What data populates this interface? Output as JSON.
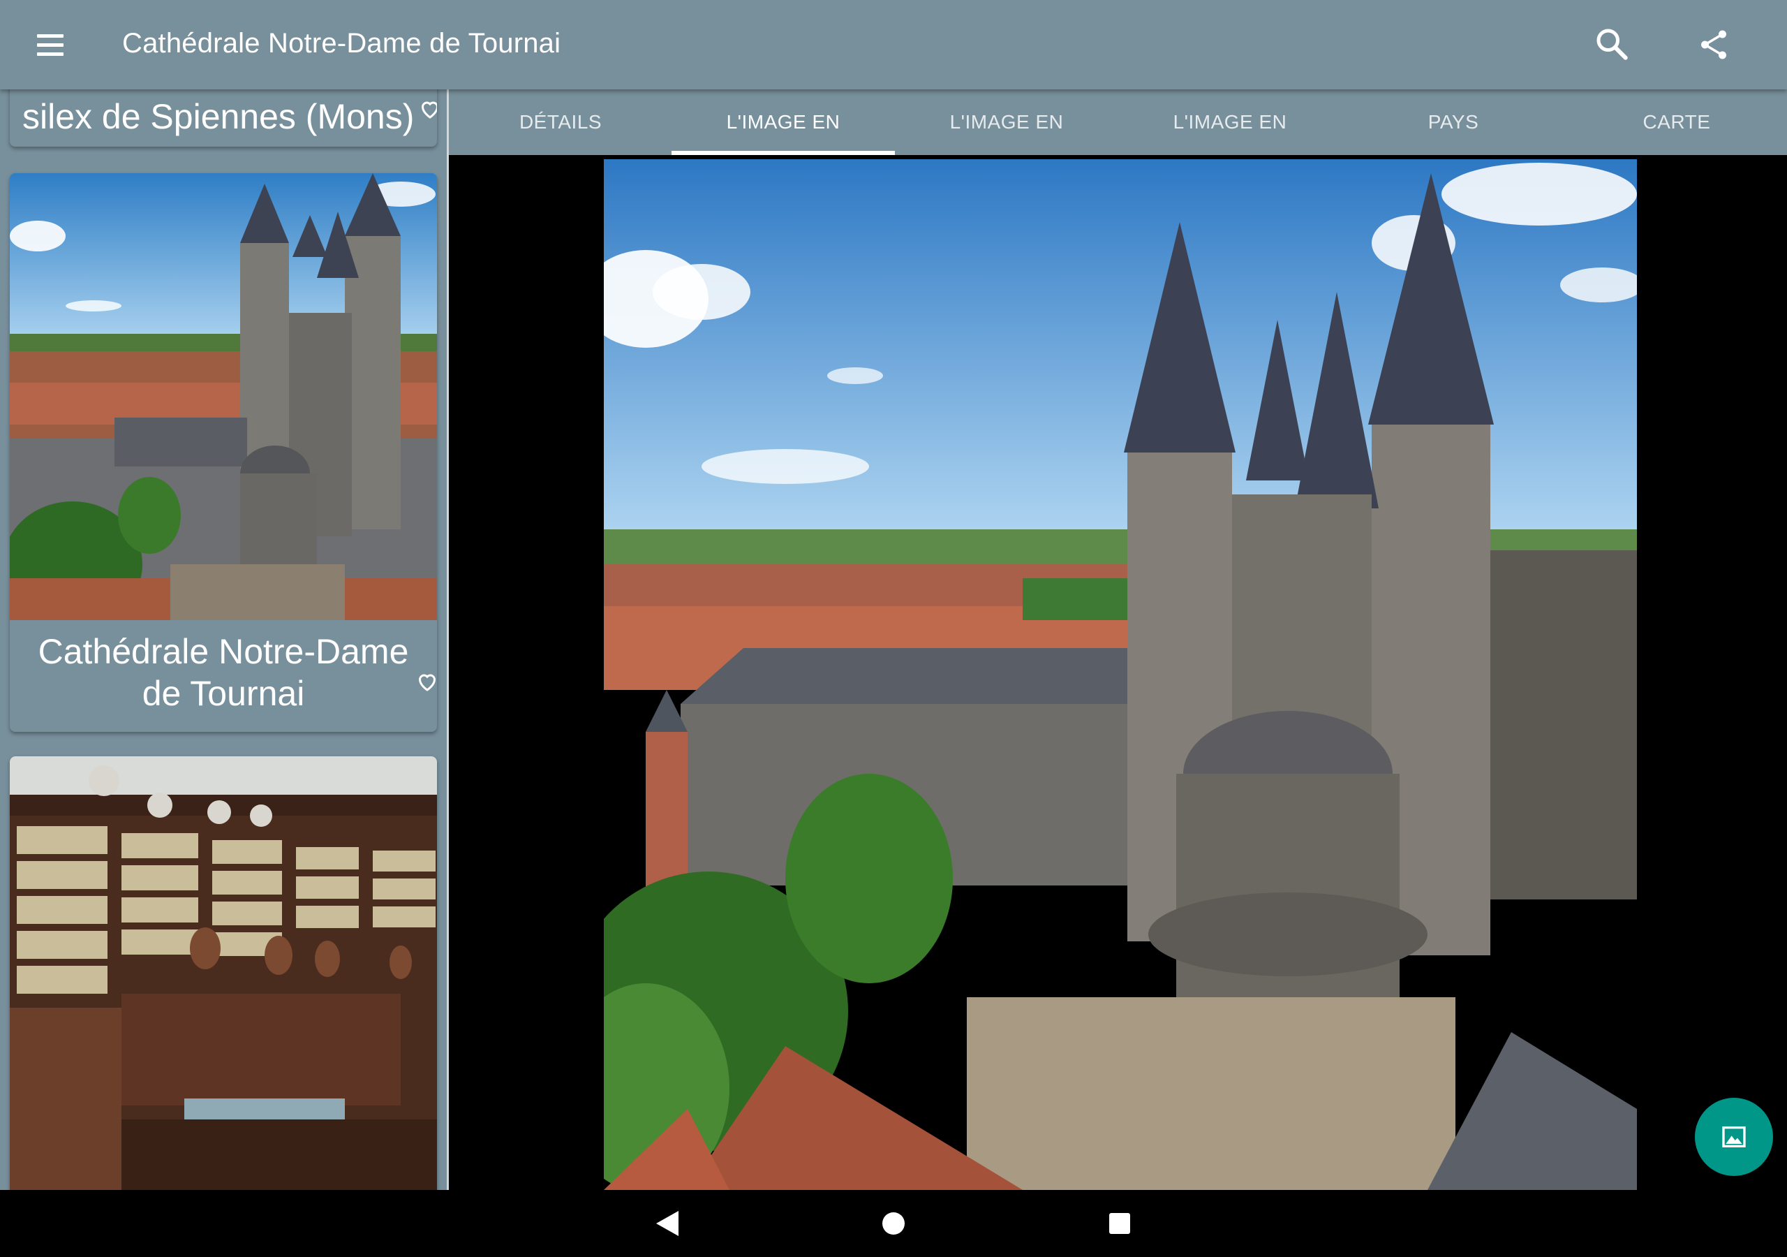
{
  "appbar": {
    "title": "Cathédrale Notre-Dame de Tournai",
    "menu_icon": "hamburger-menu-icon",
    "search_icon": "search-icon",
    "share_icon": "share-icon",
    "background_color": "#78909c"
  },
  "sidebar": {
    "cards": [
      {
        "title": "silex de Spiennes (Mons)",
        "icon": "heart-outline-icon"
      },
      {
        "title": "Cathédrale Notre-Dame de Tournai",
        "icon": "heart-outline-icon"
      },
      {
        "title": ""
      }
    ]
  },
  "tabs": [
    {
      "label": "DÉTAILS"
    },
    {
      "label": "L'IMAGE EN"
    },
    {
      "label": "L'IMAGE EN"
    },
    {
      "label": "L'IMAGE EN"
    },
    {
      "label": "PAYS"
    },
    {
      "label": "CARTE"
    }
  ],
  "selected_tab": "L'IMAGE EN",
  "fab": {
    "icon": "image-icon",
    "color": "#009688"
  },
  "system_nav": {
    "back_icon": "back-triangle-icon",
    "home_icon": "home-circle-icon",
    "recents_icon": "recents-square-icon"
  }
}
